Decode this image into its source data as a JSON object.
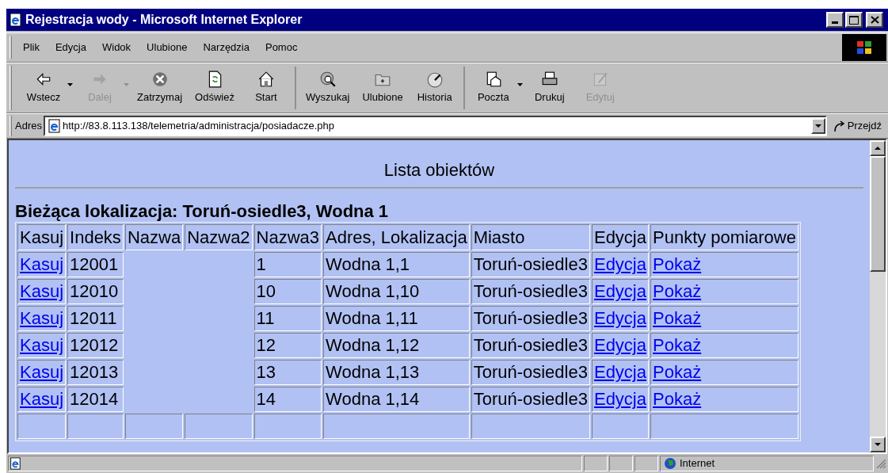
{
  "window": {
    "title": "Rejestracja wody - Microsoft Internet Explorer"
  },
  "menu": [
    "Plik",
    "Edycja",
    "Widok",
    "Ulubione",
    "Narzędzia",
    "Pomoc"
  ],
  "toolbar": [
    {
      "label": "Wstecz",
      "disabled": false,
      "dropdown": true,
      "separator_after": false
    },
    {
      "label": "Dalej",
      "disabled": true,
      "dropdown": true,
      "separator_after": false
    },
    {
      "label": "Zatrzymaj",
      "disabled": false,
      "dropdown": false,
      "separator_after": false
    },
    {
      "label": "Odśwież",
      "disabled": false,
      "dropdown": false,
      "separator_after": false
    },
    {
      "label": "Start",
      "disabled": false,
      "dropdown": false,
      "separator_after": true
    },
    {
      "label": "Wyszukaj",
      "disabled": false,
      "dropdown": false,
      "separator_after": false
    },
    {
      "label": "Ulubione",
      "disabled": false,
      "dropdown": false,
      "separator_after": false
    },
    {
      "label": "Historia",
      "disabled": false,
      "dropdown": false,
      "separator_after": true
    },
    {
      "label": "Poczta",
      "disabled": false,
      "dropdown": true,
      "separator_after": false
    },
    {
      "label": "Drukuj",
      "disabled": false,
      "dropdown": false,
      "separator_after": false
    },
    {
      "label": "Edytuj",
      "disabled": true,
      "dropdown": false,
      "separator_after": false
    }
  ],
  "address_bar": {
    "label": "Adres",
    "url": "http://83.8.113.138/telemetria/administracja/posiadacze.php",
    "go": "Przejdź"
  },
  "page": {
    "title": "Lista obiektów",
    "location": "Bieżąca lokalizacja: Toruń-osiedle3, Wodna 1",
    "table": {
      "columns": [
        {
          "label": "Kasuj",
          "kind": "link"
        },
        {
          "label": "Indeks",
          "kind": "text"
        },
        {
          "label": "Nazwa",
          "kind": "text"
        },
        {
          "label": "Nazwa2",
          "kind": "text"
        },
        {
          "label": "Nazwa3",
          "kind": "text"
        },
        {
          "label": "Adres, Lokalizacja",
          "kind": "text"
        },
        {
          "label": "Miasto",
          "kind": "text"
        },
        {
          "label": "Edycja",
          "kind": "link"
        },
        {
          "label": "Punkty pomiarowe",
          "kind": "link"
        }
      ],
      "rows": [
        [
          "Kasuj",
          "12001",
          null,
          null,
          "1",
          "Wodna 1,1",
          "Toruń-osiedle3",
          "Edycja",
          "Pokaż"
        ],
        [
          "Kasuj",
          "12010",
          null,
          null,
          "10",
          "Wodna 1,10",
          "Toruń-osiedle3",
          "Edycja",
          "Pokaż"
        ],
        [
          "Kasuj",
          "12011",
          null,
          null,
          "11",
          "Wodna 1,11",
          "Toruń-osiedle3",
          "Edycja",
          "Pokaż"
        ],
        [
          "Kasuj",
          "12012",
          null,
          null,
          "12",
          "Wodna 1,12",
          "Toruń-osiedle3",
          "Edycja",
          "Pokaż"
        ],
        [
          "Kasuj",
          "12013",
          null,
          null,
          "13",
          "Wodna 1,13",
          "Toruń-osiedle3",
          "Edycja",
          "Pokaż"
        ],
        [
          "Kasuj",
          "12014",
          null,
          null,
          "14",
          "Wodna 1,14",
          "Toruń-osiedle3",
          "Edycja",
          "Pokaż"
        ]
      ]
    }
  },
  "status_bar": {
    "zone": "Internet"
  }
}
